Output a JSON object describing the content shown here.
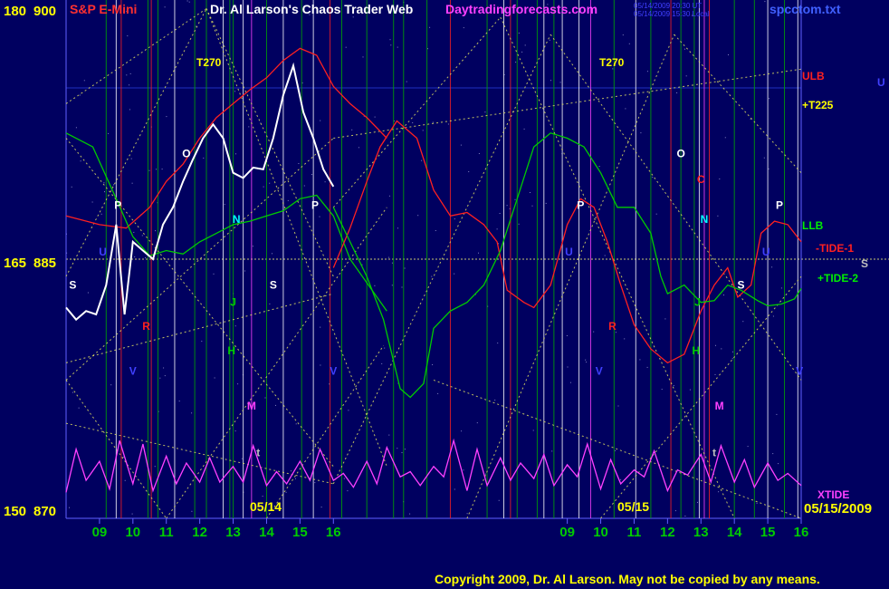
{
  "header": {
    "scale_left_top": "180",
    "price_top": "900",
    "scale_left_mid": "165",
    "price_mid": "885",
    "scale_left_bot": "150",
    "price_bot": "870",
    "symbol": "S&P E-Mini",
    "title": "Dr. Al Larson's Chaos Trader Web",
    "website": "Daytradingforecasts.com",
    "stamp_line1": "05/14/2009 20:30 UT",
    "stamp_line2": "05/14/2009 15:30 Local",
    "filename": "spcctom.txt"
  },
  "labels": {
    "t270_left": "T270",
    "t270_right": "T270",
    "ulb": "ULB",
    "t225": "+T225",
    "llb": "LLB",
    "tide1": "-TIDE-1",
    "tide2": "+TIDE-2",
    "xtide": "XTIDE",
    "s_right": "S",
    "u_right": "U",
    "date_left": "05/14",
    "date_right": "05/15",
    "date_end": "05/15/2009"
  },
  "copyright": "Copyright 2009, Dr. Al Larson. May not be copied by any means.",
  "chart_data": {
    "type": "line",
    "x_ticks_day1": [
      "09",
      "10",
      "11",
      "12",
      "13",
      "14",
      "15",
      "16"
    ],
    "x_ticks_day2": [
      "09",
      "10",
      "11",
      "12",
      "13",
      "14",
      "15",
      "16"
    ],
    "price_axis": {
      "min": 870,
      "mid": 885,
      "max": 900
    },
    "scale_axis": {
      "min": 150,
      "mid": 165,
      "max": 180
    },
    "grid": true,
    "markers": [
      {
        "text": "P",
        "hour": 9.55,
        "price": 887.9,
        "color": "#ffffff"
      },
      {
        "text": "P",
        "hour": 15.45,
        "price": 887.9,
        "color": "#ffffff"
      },
      {
        "text": "P",
        "hour": 23.4,
        "price": 887.9,
        "color": "#ffffff"
      },
      {
        "text": "P",
        "hour": 29.35,
        "price": 887.9,
        "color": "#ffffff"
      },
      {
        "text": "O",
        "hour": 11.6,
        "price": 890.9,
        "color": "#ffffff"
      },
      {
        "text": "O",
        "hour": 26.4,
        "price": 890.9,
        "color": "#ffffff"
      },
      {
        "text": "S",
        "hour": 8.2,
        "price": 883.3,
        "color": "#ffffff"
      },
      {
        "text": "S",
        "hour": 14.2,
        "price": 883.3,
        "color": "#ffffff"
      },
      {
        "text": "S",
        "hour": 28.2,
        "price": 883.3,
        "color": "#ffffff"
      },
      {
        "text": "U",
        "hour": 9.1,
        "price": 885.2,
        "color": "#4040ff"
      },
      {
        "text": "U",
        "hour": 23.05,
        "price": 885.2,
        "color": "#4040ff"
      },
      {
        "text": "U",
        "hour": 28.95,
        "price": 885.2,
        "color": "#4040ff"
      },
      {
        "text": "N",
        "hour": 13.1,
        "price": 887.1,
        "color": "#00ffff"
      },
      {
        "text": "N",
        "hour": 27.1,
        "price": 887.1,
        "color": "#00ffff"
      },
      {
        "text": "R",
        "hour": 10.4,
        "price": 880.9,
        "color": "#ff2020"
      },
      {
        "text": "R",
        "hour": 24.35,
        "price": 880.9,
        "color": "#ff2020"
      },
      {
        "text": "C",
        "hour": 27.0,
        "price": 889.4,
        "color": "#ff2020"
      },
      {
        "text": "J",
        "hour": 13.0,
        "price": 882.3,
        "color": "#00cc00"
      },
      {
        "text": "J",
        "hour": 26.9,
        "price": 882.3,
        "color": "#00cc00"
      },
      {
        "text": "H",
        "hour": 12.95,
        "price": 879.5,
        "color": "#00cc00"
      },
      {
        "text": "H",
        "hour": 26.85,
        "price": 879.5,
        "color": "#00cc00"
      },
      {
        "text": "V",
        "hour": 10.0,
        "price": 878.3,
        "color": "#4040ff"
      },
      {
        "text": "V",
        "hour": 16.0,
        "price": 878.3,
        "color": "#4040ff"
      },
      {
        "text": "V",
        "hour": 23.95,
        "price": 878.3,
        "color": "#4040ff"
      },
      {
        "text": "V",
        "hour": 29.95,
        "price": 878.3,
        "color": "#4040ff"
      },
      {
        "text": "M",
        "hour": 13.55,
        "price": 876.3,
        "color": "#ff40ff"
      },
      {
        "text": "M",
        "hour": 27.55,
        "price": 876.3,
        "color": "#ff40ff"
      },
      {
        "text": "t",
        "hour": 13.75,
        "price": 873.6,
        "color": "#c0c0c0"
      },
      {
        "text": "t",
        "hour": 27.4,
        "price": 873.6,
        "color": "#c0c0c0"
      }
    ],
    "series": [
      {
        "name": "ULB",
        "color": "#ff2020",
        "x": [
          8.0,
          9.0,
          9.8,
          10.5,
          11.0,
          11.5,
          12.0,
          12.5,
          13.0,
          13.5,
          14.0,
          14.5,
          15.0,
          15.5,
          16.0,
          16.5,
          17.0,
          17.6
        ],
        "y": [
          887.5,
          887.0,
          886.8,
          888.0,
          889.5,
          890.5,
          892.0,
          893.2,
          894.0,
          894.8,
          895.5,
          896.5,
          897.2,
          896.8,
          895.0,
          894.0,
          893.2,
          892.0
        ]
      },
      {
        "name": "LLB",
        "color": "#00cc00",
        "x": [
          8.0,
          8.8,
          9.5,
          10.0,
          10.5,
          11.0,
          11.5,
          12.0,
          12.5,
          13.0,
          13.5,
          14.0,
          14.5,
          15.0,
          15.5,
          16.0,
          16.5,
          17.6
        ],
        "y": [
          892.3,
          891.5,
          888.5,
          886.3,
          885.2,
          885.5,
          885.3,
          886.0,
          886.5,
          887.0,
          887.2,
          887.5,
          887.8,
          888.5,
          888.7,
          887.5,
          885.0,
          882.0
        ]
      },
      {
        "name": "-TIDE-1",
        "color": "#ff2020",
        "x": [
          16.0,
          16.5,
          17.0,
          17.4,
          17.9,
          18.5,
          19.0,
          19.5,
          20.0,
          20.5,
          20.9,
          21.2,
          21.7,
          22.0,
          22.5,
          23.0,
          23.4,
          23.8,
          24.2,
          24.6,
          25.0,
          25.5,
          26.0,
          26.5,
          27.0,
          27.4,
          27.8,
          28.1,
          28.5,
          28.8,
          29.2,
          29.6,
          30.0
        ],
        "y": [
          884.5,
          886.8,
          889.5,
          891.5,
          893.0,
          892.0,
          889.0,
          887.5,
          887.7,
          887.0,
          886.0,
          883.2,
          882.5,
          882.2,
          883.5,
          887.0,
          888.5,
          888.0,
          886.0,
          883.5,
          881.2,
          879.8,
          879.0,
          879.5,
          882.0,
          883.5,
          884.5,
          882.8,
          883.5,
          886.5,
          887.2,
          887.0,
          886.0
        ]
      },
      {
        "name": "+TIDE-2",
        "color": "#00cc00",
        "x": [
          16.0,
          16.5,
          17.0,
          17.5,
          18.0,
          18.3,
          18.7,
          19.0,
          19.5,
          20.0,
          20.5,
          21.0,
          21.5,
          22.0,
          22.5,
          23.0,
          23.5,
          24.0,
          24.5,
          25.0,
          25.5,
          25.8,
          26.0,
          26.5,
          27.0,
          27.4,
          27.8,
          28.2,
          28.7,
          29.0,
          29.4,
          29.8,
          30.0
        ],
        "y": [
          888.0,
          886.0,
          884.0,
          881.5,
          877.5,
          877.0,
          877.8,
          881.0,
          882.0,
          882.5,
          883.5,
          885.5,
          888.5,
          891.5,
          892.3,
          892.0,
          891.5,
          890.0,
          888.0,
          888.0,
          886.5,
          884.0,
          883.0,
          883.5,
          882.5,
          882.6,
          883.5,
          883.2,
          882.6,
          882.3,
          882.4,
          882.7,
          883.3
        ]
      },
      {
        "name": "XTIDE",
        "color": "#ff40ff",
        "x": [
          8.0,
          8.3,
          8.6,
          9.0,
          9.3,
          9.6,
          10.0,
          10.3,
          10.6,
          11.0,
          11.3,
          11.6,
          12.0,
          12.3,
          12.6,
          13.0,
          13.3,
          13.6,
          14.0,
          14.3,
          14.6,
          15.0,
          15.3,
          15.6,
          16.0,
          16.3,
          16.6,
          17.0,
          17.3,
          17.6,
          18.0,
          18.3,
          18.6,
          19.0,
          19.3,
          19.6,
          20.0,
          20.3,
          20.6,
          21.0,
          21.3,
          21.6,
          22.0,
          22.3,
          22.6,
          23.0,
          23.3,
          23.6,
          24.0,
          24.3,
          24.6,
          25.0,
          25.3,
          25.6,
          26.0,
          26.3,
          26.6,
          27.0,
          27.3,
          27.6,
          28.0,
          28.3,
          28.6,
          29.0,
          29.3,
          29.6,
          30.0
        ],
        "y": [
          871.5,
          874.0,
          872.2,
          873.3,
          871.7,
          874.5,
          872.0,
          874.3,
          871.6,
          873.6,
          872.0,
          873.2,
          872.1,
          873.5,
          872.1,
          873.0,
          872.1,
          874.2,
          871.9,
          872.7,
          872.0,
          873.3,
          872.2,
          874.0,
          872.2,
          872.6,
          871.8,
          873.3,
          872.0,
          874.1,
          872.4,
          872.7,
          871.9,
          873.0,
          872.4,
          874.5,
          871.6,
          874.0,
          871.9,
          873.5,
          872.2,
          873.2,
          872.3,
          873.7,
          871.9,
          873.1,
          872.4,
          874.3,
          871.7,
          873.4,
          872.0,
          872.8,
          872.4,
          873.9,
          871.6,
          872.8,
          872.5,
          873.7,
          872.1,
          874.2,
          872.1,
          873.4,
          871.8,
          873.2,
          872.2,
          872.6,
          871.9
        ]
      },
      {
        "name": "price",
        "color": "#ffffff",
        "x": [
          8.0,
          8.3,
          8.6,
          8.9,
          9.2,
          9.5,
          9.75,
          10.0,
          10.3,
          10.6,
          10.9,
          11.2,
          11.5,
          11.8,
          12.1,
          12.4,
          12.7,
          13.0,
          13.3,
          13.6,
          13.9,
          14.2,
          14.5,
          14.8,
          15.1,
          15.4,
          15.7,
          16.0
        ],
        "y": [
          882.2,
          881.5,
          882.0,
          881.8,
          883.5,
          887.0,
          881.8,
          886.0,
          885.5,
          885.0,
          887.0,
          888.0,
          889.5,
          890.8,
          892.0,
          892.8,
          892.0,
          890.0,
          889.7,
          890.3,
          890.2,
          892.0,
          894.5,
          896.2,
          893.5,
          892.0,
          890.2,
          889.2
        ]
      }
    ]
  }
}
